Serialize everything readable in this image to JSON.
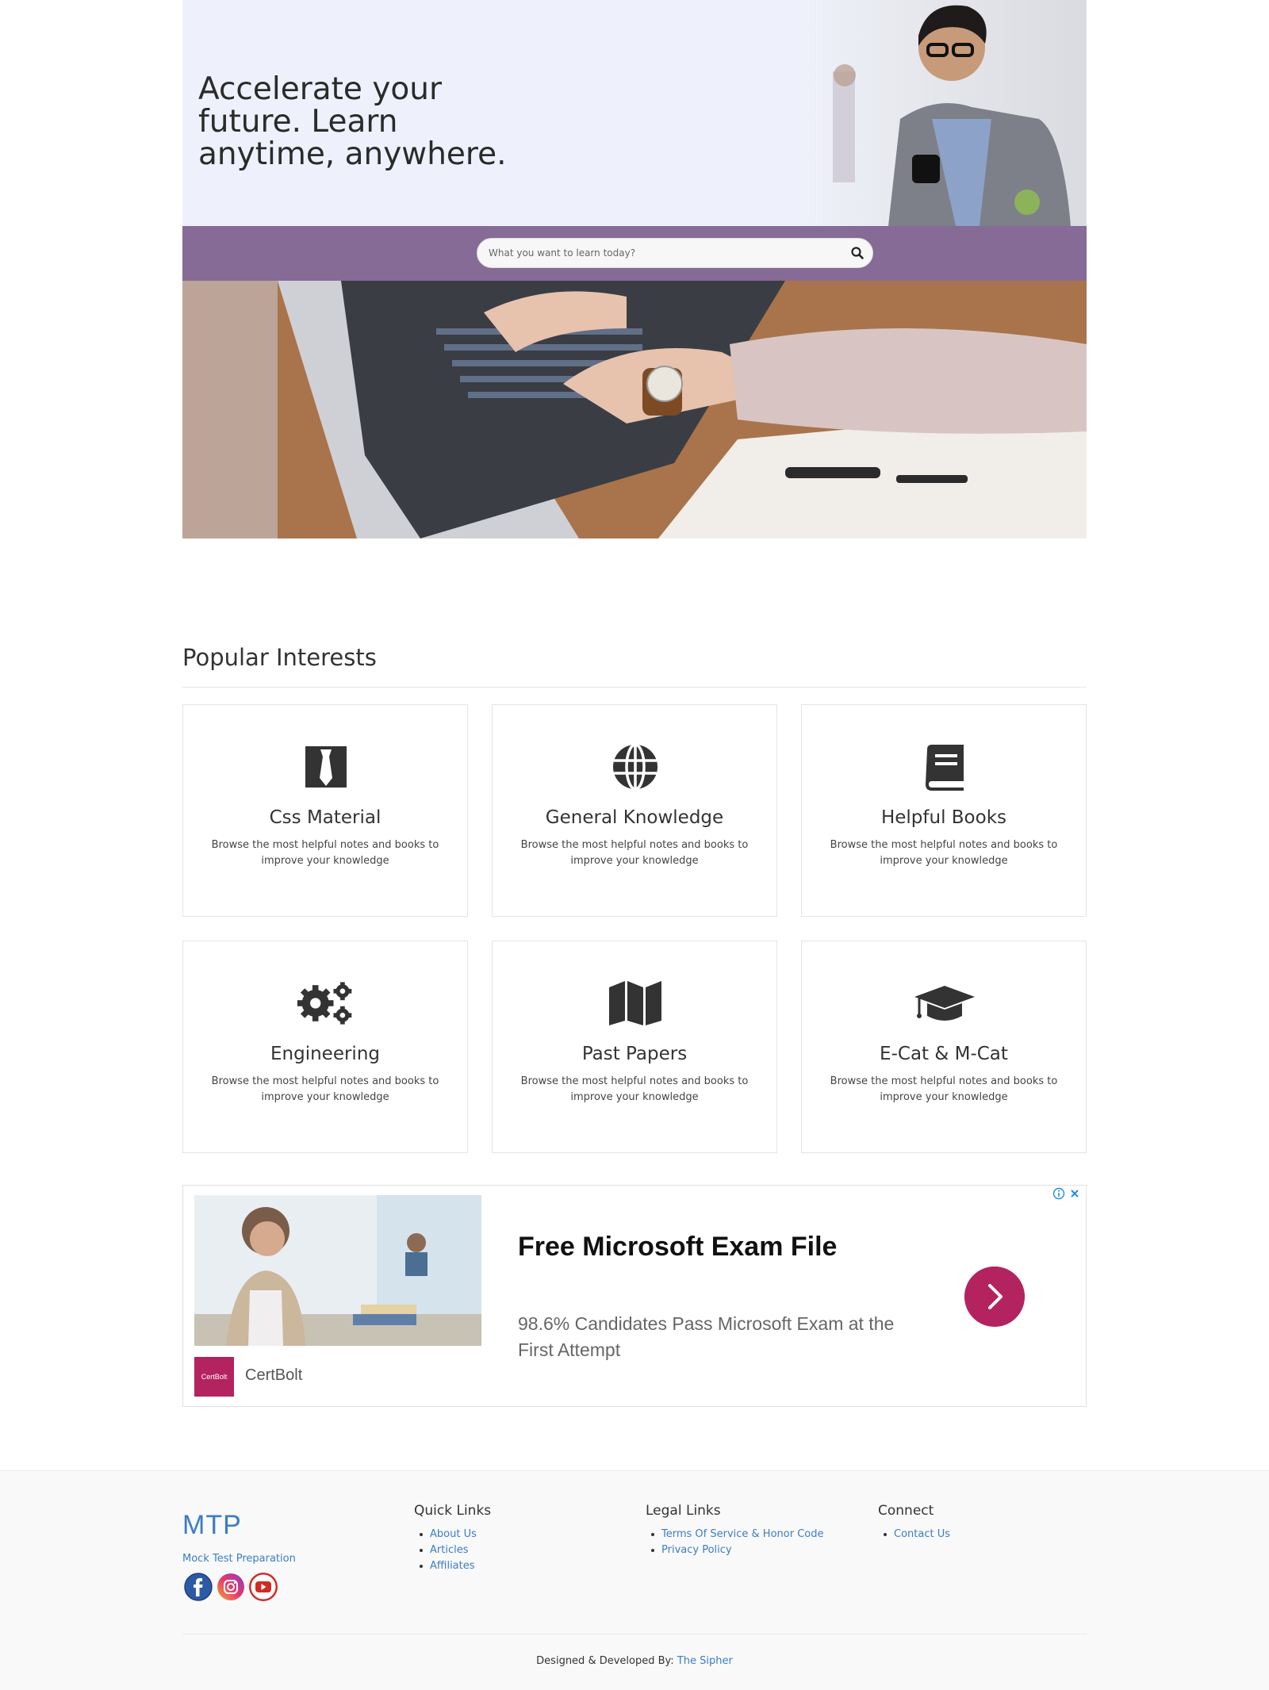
{
  "hero": {
    "title": "Accelerate your future. Learn anytime, anywhere."
  },
  "search": {
    "placeholder": "What you want to learn today?",
    "icon": "search-icon"
  },
  "interests": {
    "title": "Popular Interests",
    "cards": [
      {
        "title": "Css Material",
        "desc": "Browse the most helpful notes and books to improve your knowledge",
        "icon": "tie-icon"
      },
      {
        "title": "General Knowledge",
        "desc": "Browse the most helpful notes and books to improve your knowledge",
        "icon": "globe-icon"
      },
      {
        "title": "Helpful Books",
        "desc": "Browse the most helpful notes and books to improve your knowledge",
        "icon": "book-icon"
      },
      {
        "title": "Engineering",
        "desc": "Browse the most helpful notes and books to improve your knowledge",
        "icon": "gears-icon"
      },
      {
        "title": "Past Papers",
        "desc": "Browse the most helpful notes and books to improve your knowledge",
        "icon": "map-icon"
      },
      {
        "title": "E-Cat & M-Cat",
        "desc": "Browse the most helpful notes and books to improve your knowledge",
        "icon": "graduation-cap-icon"
      }
    ]
  },
  "ad": {
    "headline": "Free Microsoft Exam File",
    "body": "98.6% Candidates Pass Microsoft Exam at the First Attempt",
    "brand": "CertBolt",
    "logo_text": "CertBolt",
    "accent": "#b3235f"
  },
  "footer": {
    "brand": "MTP",
    "brand_sub": "Mock Test Preparation",
    "quick_links": {
      "title": "Quick Links",
      "items": [
        "About Us",
        "Articles",
        "Affiliates"
      ]
    },
    "legal_links": {
      "title": "Legal Links",
      "items": [
        "Terms Of Service & Honor Code",
        "Privacy Policy"
      ]
    },
    "connect": {
      "title": "Connect",
      "items": [
        "Contact Us"
      ]
    },
    "credit_prefix": "Designed & Developed By:",
    "credit_link": "The Sipher",
    "social": [
      "facebook-icon",
      "instagram-icon",
      "youtube-icon"
    ]
  },
  "colors": {
    "search_band": "#856b96",
    "hero_bg": "#eef1fb",
    "link": "#3b7dc4"
  }
}
